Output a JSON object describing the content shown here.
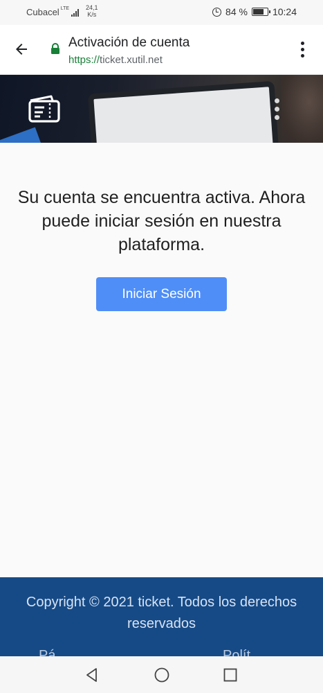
{
  "status_bar": {
    "carrier": "Cubacel",
    "network_type": "LTE",
    "speed_value": "24,1",
    "speed_unit": "K/s",
    "battery": "84 %",
    "time": "10:24"
  },
  "browser": {
    "page_title": "Activación de cuenta",
    "url_scheme": "https://",
    "url_host": "ticket.xutil.net"
  },
  "main": {
    "message": "Su cuenta se encuentra activa. Ahora puede iniciar sesión en nuestra plataforma.",
    "login_button": "Iniciar Sesión"
  },
  "footer": {
    "copyright": "Copyright © 2021 ticket. Todos los derechos reservados",
    "link_left": "Pá...",
    "link_right": "Polít..."
  },
  "colors": {
    "accent_button": "#4f8ef7",
    "footer_bg": "#164a86",
    "url_secure": "#188038"
  },
  "icons": {
    "back": "back-arrow-icon",
    "lock": "lock-icon",
    "menu": "more-vert-icon",
    "logo": "ticket-logo-icon",
    "nav_back": "nav-back-icon",
    "nav_home": "nav-home-icon",
    "nav_recents": "nav-recents-icon"
  }
}
